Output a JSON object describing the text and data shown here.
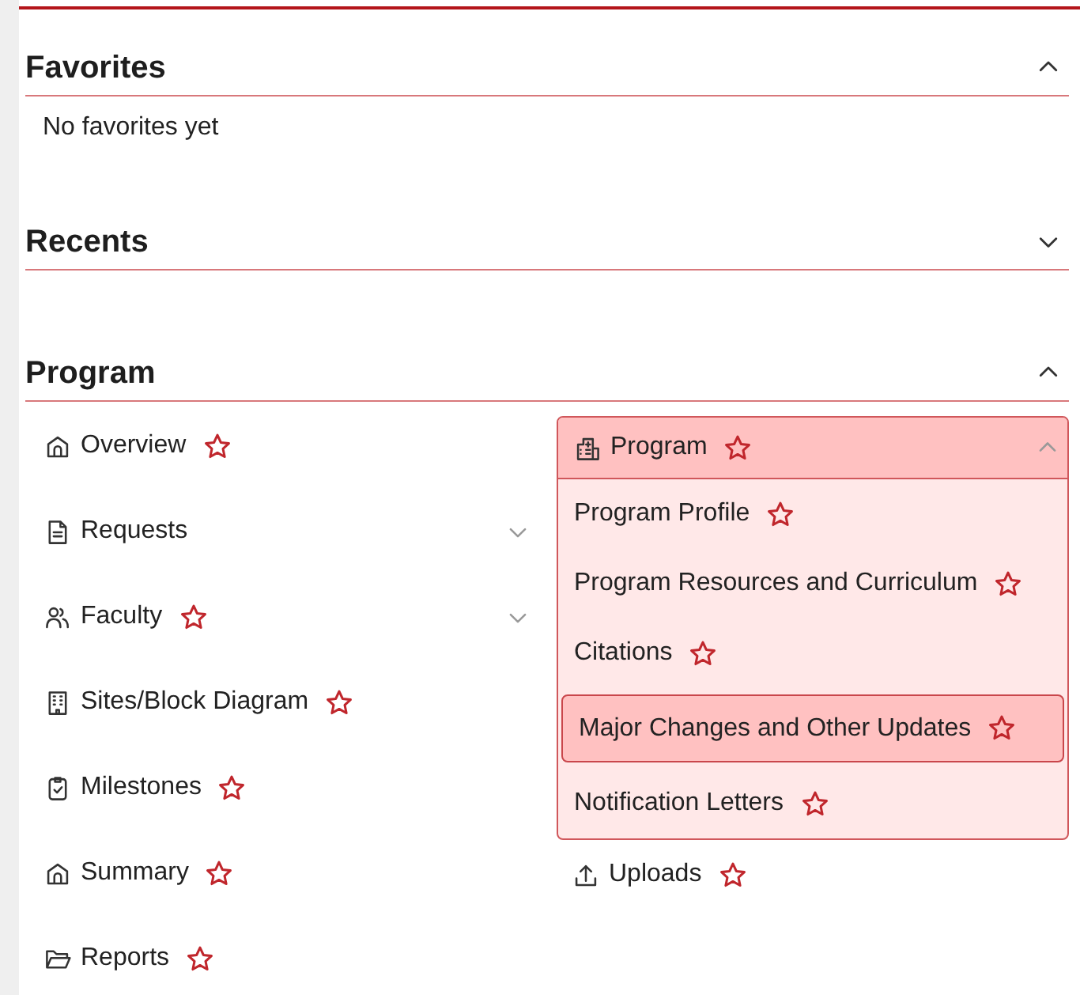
{
  "sections": [
    {
      "title": "Favorites",
      "expanded": true,
      "message": "No favorites yet"
    },
    {
      "title": "Recents",
      "expanded": false
    },
    {
      "title": "Program",
      "expanded": true,
      "columns": [
        [
          {
            "label": "Overview",
            "favoritable": true
          },
          {
            "label": "Requests",
            "favoritable": false,
            "expanded": false
          },
          {
            "label": "Faculty",
            "favoritable": true,
            "expanded": false
          },
          {
            "label": "Sites/Block Diagram",
            "favoritable": true
          },
          {
            "label": "Milestones",
            "favoritable": true
          },
          {
            "label": "Summary",
            "favoritable": true
          },
          {
            "label": "Reports",
            "favoritable": true
          }
        ],
        [
          {
            "label": "Program",
            "favoritable": true,
            "expanded": true,
            "children": [
              {
                "label": "Program Profile",
                "favoritable": true,
                "selected": false
              },
              {
                "label": "Program Resources and Curriculum",
                "favoritable": true,
                "selected": false
              },
              {
                "label": "Citations",
                "favoritable": true,
                "selected": false
              },
              {
                "label": "Major Changes and Other Updates",
                "favoritable": true,
                "selected": true
              },
              {
                "label": "Notification Letters",
                "favoritable": true,
                "selected": false
              }
            ]
          },
          {
            "label": "Uploads",
            "favoritable": true
          }
        ]
      ]
    }
  ]
}
